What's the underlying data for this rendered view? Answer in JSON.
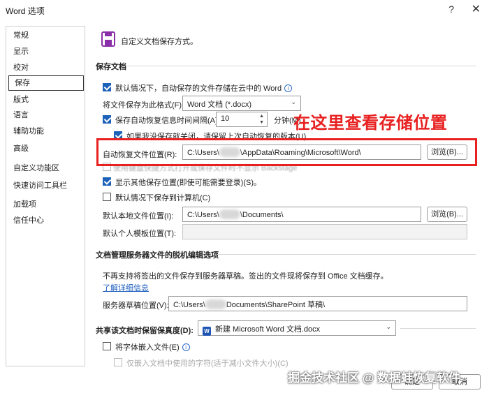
{
  "window": {
    "title": "Word 选项",
    "help": "?",
    "close": "✕"
  },
  "sidebar": {
    "items": [
      {
        "label": "常规"
      },
      {
        "label": "显示"
      },
      {
        "label": "校对"
      },
      {
        "label": "保存"
      },
      {
        "label": "版式"
      },
      {
        "label": "语言"
      },
      {
        "label": "辅助功能"
      },
      {
        "label": "高级"
      },
      {
        "label": "自定义功能区"
      },
      {
        "label": "快速访问工具栏"
      },
      {
        "label": "加载项"
      },
      {
        "label": "信任中心"
      }
    ],
    "active_index": 3
  },
  "header": {
    "text": "自定义文档保存方式。"
  },
  "save_docs": {
    "section_title": "保存文档",
    "cloud_default": {
      "label": "默认情况下，自动保存的文件存储在云中的 Word",
      "checked": true
    },
    "format": {
      "label": "将文件保存为此格式(F):",
      "value": "Word 文档 (*.docx)"
    },
    "autorecover_interval": {
      "label": "保存自动恢复信息时间间隔(A)",
      "value": "10",
      "unit": "分钟(M)",
      "checked": true
    },
    "keep_last": {
      "label": "如果我没保存就关闭，请保留上次自动恢复的版本(U)",
      "checked": true
    },
    "autorecover_location": {
      "label": "自动恢复文件位置(R):",
      "path_start": "C:\\Users\\",
      "path_end": "\\AppData\\Roaming\\Microsoft\\Word\\",
      "browse": "浏览(B)..."
    },
    "overlap_text": "使用键盘快捷方式打开或保存文件时不显示 Backstage",
    "show_more": {
      "label": "显示其他保存位置(即使可能需要登录)(S)。",
      "checked": true
    },
    "save_computer": {
      "label": "默认情况下保存到计算机(C)",
      "checked": false
    },
    "local_location": {
      "label": "默认本地文件位置(I):",
      "path_start": "C:\\Users\\",
      "path_end": "\\Documents\\",
      "browse": "浏览(B)..."
    },
    "template_location": {
      "label": "默认个人模板位置(T):",
      "value": ""
    }
  },
  "offline": {
    "section_title": "文档管理服务器文件的脱机编辑选项",
    "desc": "不再支持将签出的文件保存到服务器草稿。签出的文件现将保存到 Office 文档缓存。",
    "learn_more": "了解详细信息",
    "drafts": {
      "label": "服务器草稿位置(V):",
      "path_start": "C:\\Users\\",
      "path_end": "Documents\\SharePoint 草稿\\"
    }
  },
  "fidelity": {
    "label": "共享该文档时保留保真度(D):",
    "doc": "新建 Microsoft Word 文档.docx",
    "embed": {
      "label": "将字体嵌入文件(E)",
      "checked": false
    },
    "embed_only": {
      "label": "仅嵌入文档中使用的字符(适于减小文件大小)(C)",
      "checked": false
    }
  },
  "footer": {
    "ok": "确定",
    "cancel": "取消"
  },
  "annotation": {
    "text": "在这里查看存储位置",
    "color": "#e82020"
  },
  "watermark": {
    "text": "掘金技术社区 @ 数据蛙恢复软件"
  },
  "colors": {
    "accent": "#1c62b9",
    "link": "#1f5fbf"
  }
}
